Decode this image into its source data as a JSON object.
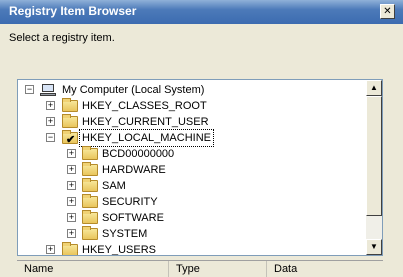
{
  "window": {
    "title": "Registry Item Browser",
    "close_glyph": "✕"
  },
  "prompt": "Select a registry item.",
  "tree": {
    "root": {
      "label": "My Computer (Local System)",
      "icon": "computer-icon",
      "expander": "−"
    },
    "items": [
      {
        "label": "HKEY_CLASSES_ROOT",
        "expander": "+",
        "level": 1
      },
      {
        "label": "HKEY_CURRENT_USER",
        "expander": "+",
        "level": 1
      },
      {
        "label": "HKEY_LOCAL_MACHINE",
        "expander": "−",
        "level": 1,
        "checked": true,
        "selected": true
      },
      {
        "label": "BCD00000000",
        "expander": "+",
        "level": 2
      },
      {
        "label": "HARDWARE",
        "expander": "+",
        "level": 2
      },
      {
        "label": "SAM",
        "expander": "+",
        "level": 2
      },
      {
        "label": "SECURITY",
        "expander": "+",
        "level": 2
      },
      {
        "label": "SOFTWARE",
        "expander": "+",
        "level": 2
      },
      {
        "label": "SYSTEM",
        "expander": "+",
        "level": 2
      },
      {
        "label": "HKEY_USERS",
        "expander": "+",
        "level": 1
      }
    ],
    "scroll_up_glyph": "▲",
    "scroll_down_glyph": "▼",
    "check_glyph": "✔"
  },
  "columns": [
    "Name",
    "Type",
    "Data"
  ]
}
